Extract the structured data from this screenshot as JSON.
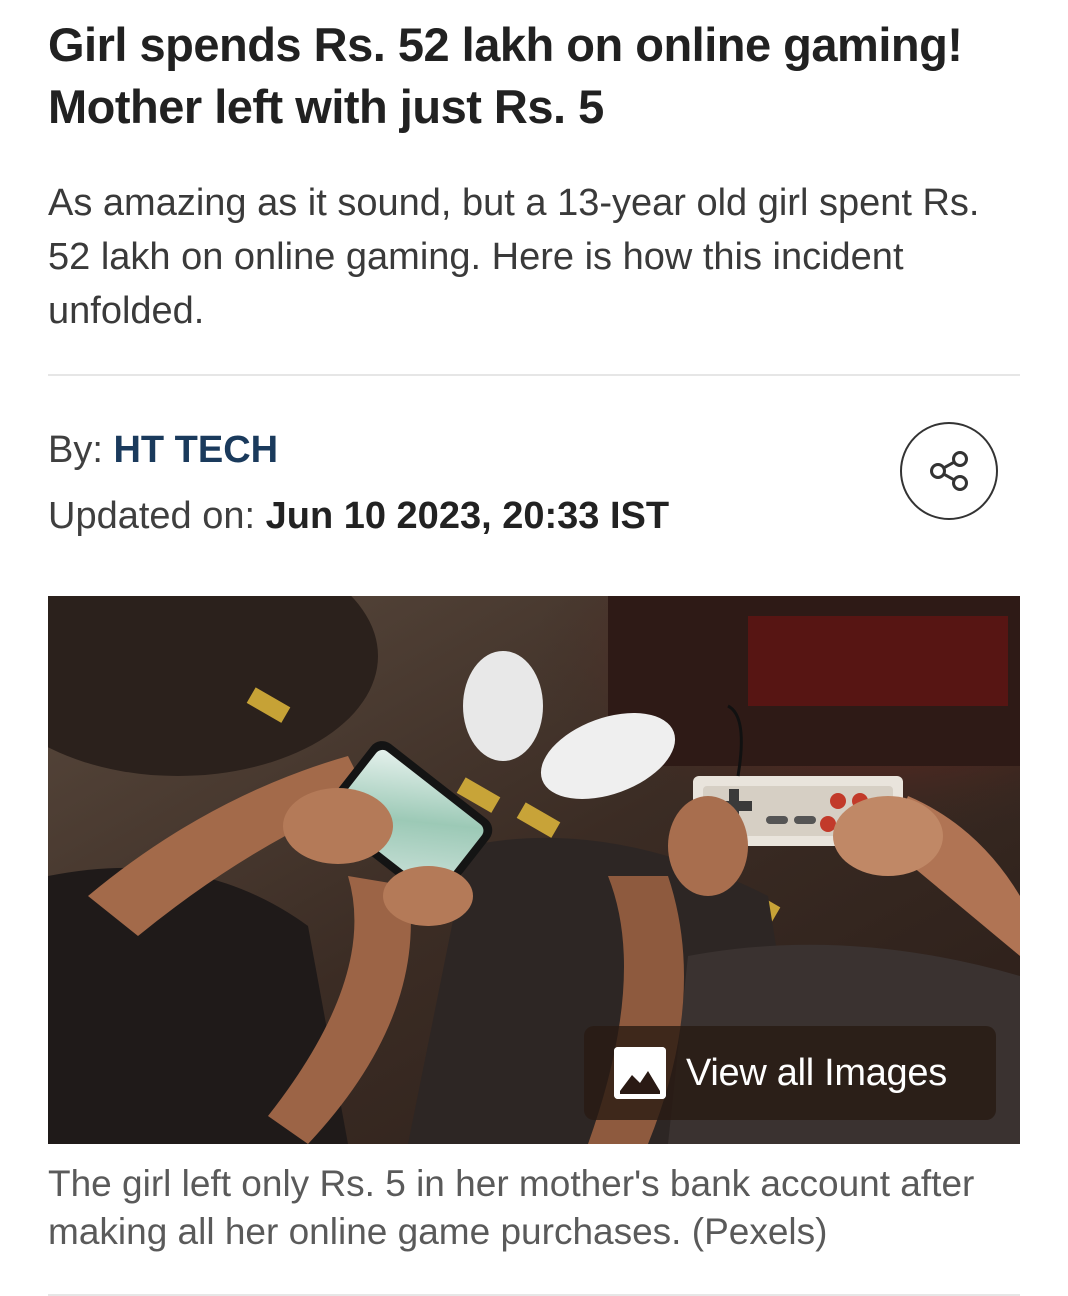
{
  "article": {
    "headline": "Girl spends Rs. 52 lakh on online gaming! Mother left with just Rs. 5",
    "summary": "As amazing as it sound, but a 13-year old girl spent Rs. 52 lakh on online gaming. Here is how this incident unfolded.",
    "byline_prefix": "By: ",
    "author": "HT TECH",
    "updated_prefix": "Updated on: ",
    "updated_date": "Jun 10 2023, 20:33 IST",
    "share_icon": "share-icon",
    "image": {
      "view_all_label": "View all Images",
      "view_all_icon": "image-gallery-icon",
      "caption": "The girl left only Rs. 5 in her mother's bank account after making all her online game purchases. (Pexels)"
    }
  },
  "colors": {
    "author": "#1a3a5c",
    "text": "#222222",
    "summary": "#3a3a3a",
    "caption": "#5a5a5a",
    "divider": "#e6e6e6"
  }
}
